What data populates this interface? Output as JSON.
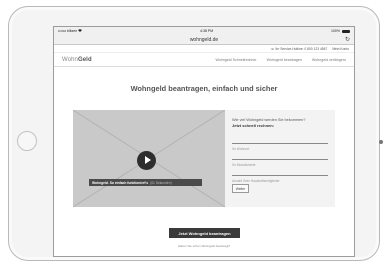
{
  "device": {
    "status": {
      "carrier": "•••••o blitzen",
      "wifi_icon": "wifi-icon",
      "time": "4:38 PM",
      "battery_pct": "100%",
      "battery_icon": "battery-icon"
    },
    "browser": {
      "url": "wohngeld.de",
      "reload_icon": "reload-icon"
    }
  },
  "site": {
    "topbar": {
      "hotline": "☏ Ihr Service-Hotline: 0 800 123 4567",
      "contact": "Mein Konto"
    },
    "logo": {
      "part1": "Wohn",
      "part2": "Geld"
    },
    "nav": [
      "Wohngeld Schnellrechner",
      "Wohngeld beantragen",
      "Wohngeld verlängern"
    ],
    "headline": "Wohngeld beantragen, einfach und sicher",
    "video": {
      "caption_bold": "Wohngeld. So einfach funktioniert's",
      "caption_time": "(01 Sekunden)",
      "play_icon": "play-icon"
    },
    "calculator": {
      "question": "Wie viel Wohngeld werden Sie bekommen?",
      "heading": "Jetzt schnell rechnen:",
      "fields": [
        {
          "placeholder": "Ihr Wohnort",
          "value": ""
        },
        {
          "placeholder": "Ihr Monatsmiete",
          "value": ""
        },
        {
          "placeholder": "Anzahl Ihrer Haushaltsmitglieder",
          "value": ""
        }
      ],
      "submit": "Weiter"
    },
    "cta": "Jetzt Wohngeld beantragen",
    "sublink": "Haben Sie schon Wohngeld beantragt?"
  }
}
